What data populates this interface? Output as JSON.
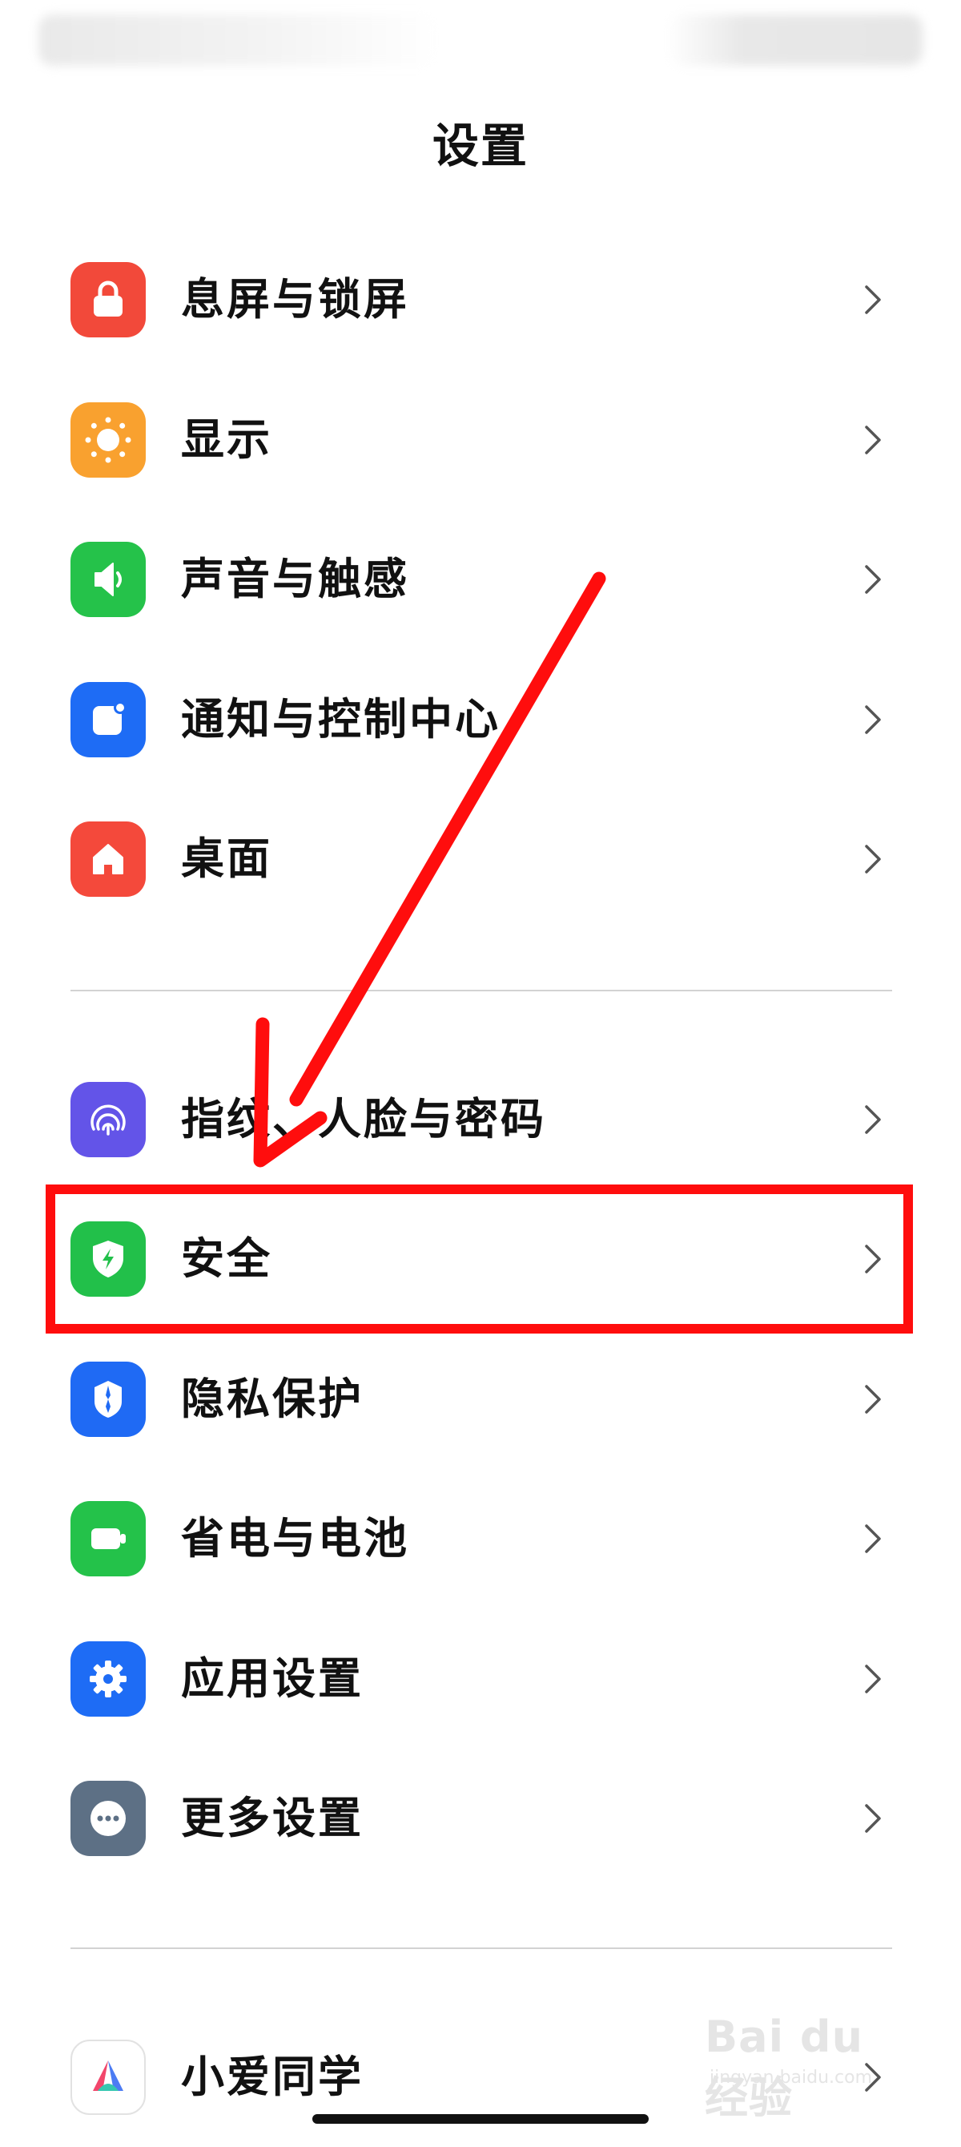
{
  "header": {
    "title": "设置"
  },
  "items": [
    {
      "label": "息屏与锁屏",
      "icon": "lock-icon",
      "color": "#F2493A"
    },
    {
      "label": "显示",
      "icon": "sun-icon",
      "color": "#F9A12F"
    },
    {
      "label": "声音与触感",
      "icon": "speaker-icon",
      "color": "#25C24A"
    },
    {
      "label": "通知与控制中心",
      "icon": "notification-icon",
      "color": "#1E6CF5"
    },
    {
      "label": "桌面",
      "icon": "home-icon",
      "color": "#F4493B"
    },
    {
      "label": "指纹、人脸与密码",
      "icon": "fingerprint-icon",
      "color": "#6354E8"
    },
    {
      "label": "安全",
      "icon": "shield-icon",
      "color": "#22C04A"
    },
    {
      "label": "隐私保护",
      "icon": "privacy-icon",
      "color": "#1F6AF4"
    },
    {
      "label": "省电与电池",
      "icon": "battery-icon",
      "color": "#24C24A"
    },
    {
      "label": "应用设置",
      "icon": "gear-icon",
      "color": "#1E6CF5"
    },
    {
      "label": "更多设置",
      "icon": "more-icon",
      "color": "#5D7085"
    },
    {
      "label": "小爱同学",
      "icon": "xiaoai-icon",
      "color": "#FFFFFF"
    }
  ],
  "annotation": {
    "highlight_color": "#FF0D0D",
    "highlighted_item": "安全"
  },
  "watermark": {
    "main": "Bai du 经验",
    "sub": "jingyan.baidu.com"
  }
}
